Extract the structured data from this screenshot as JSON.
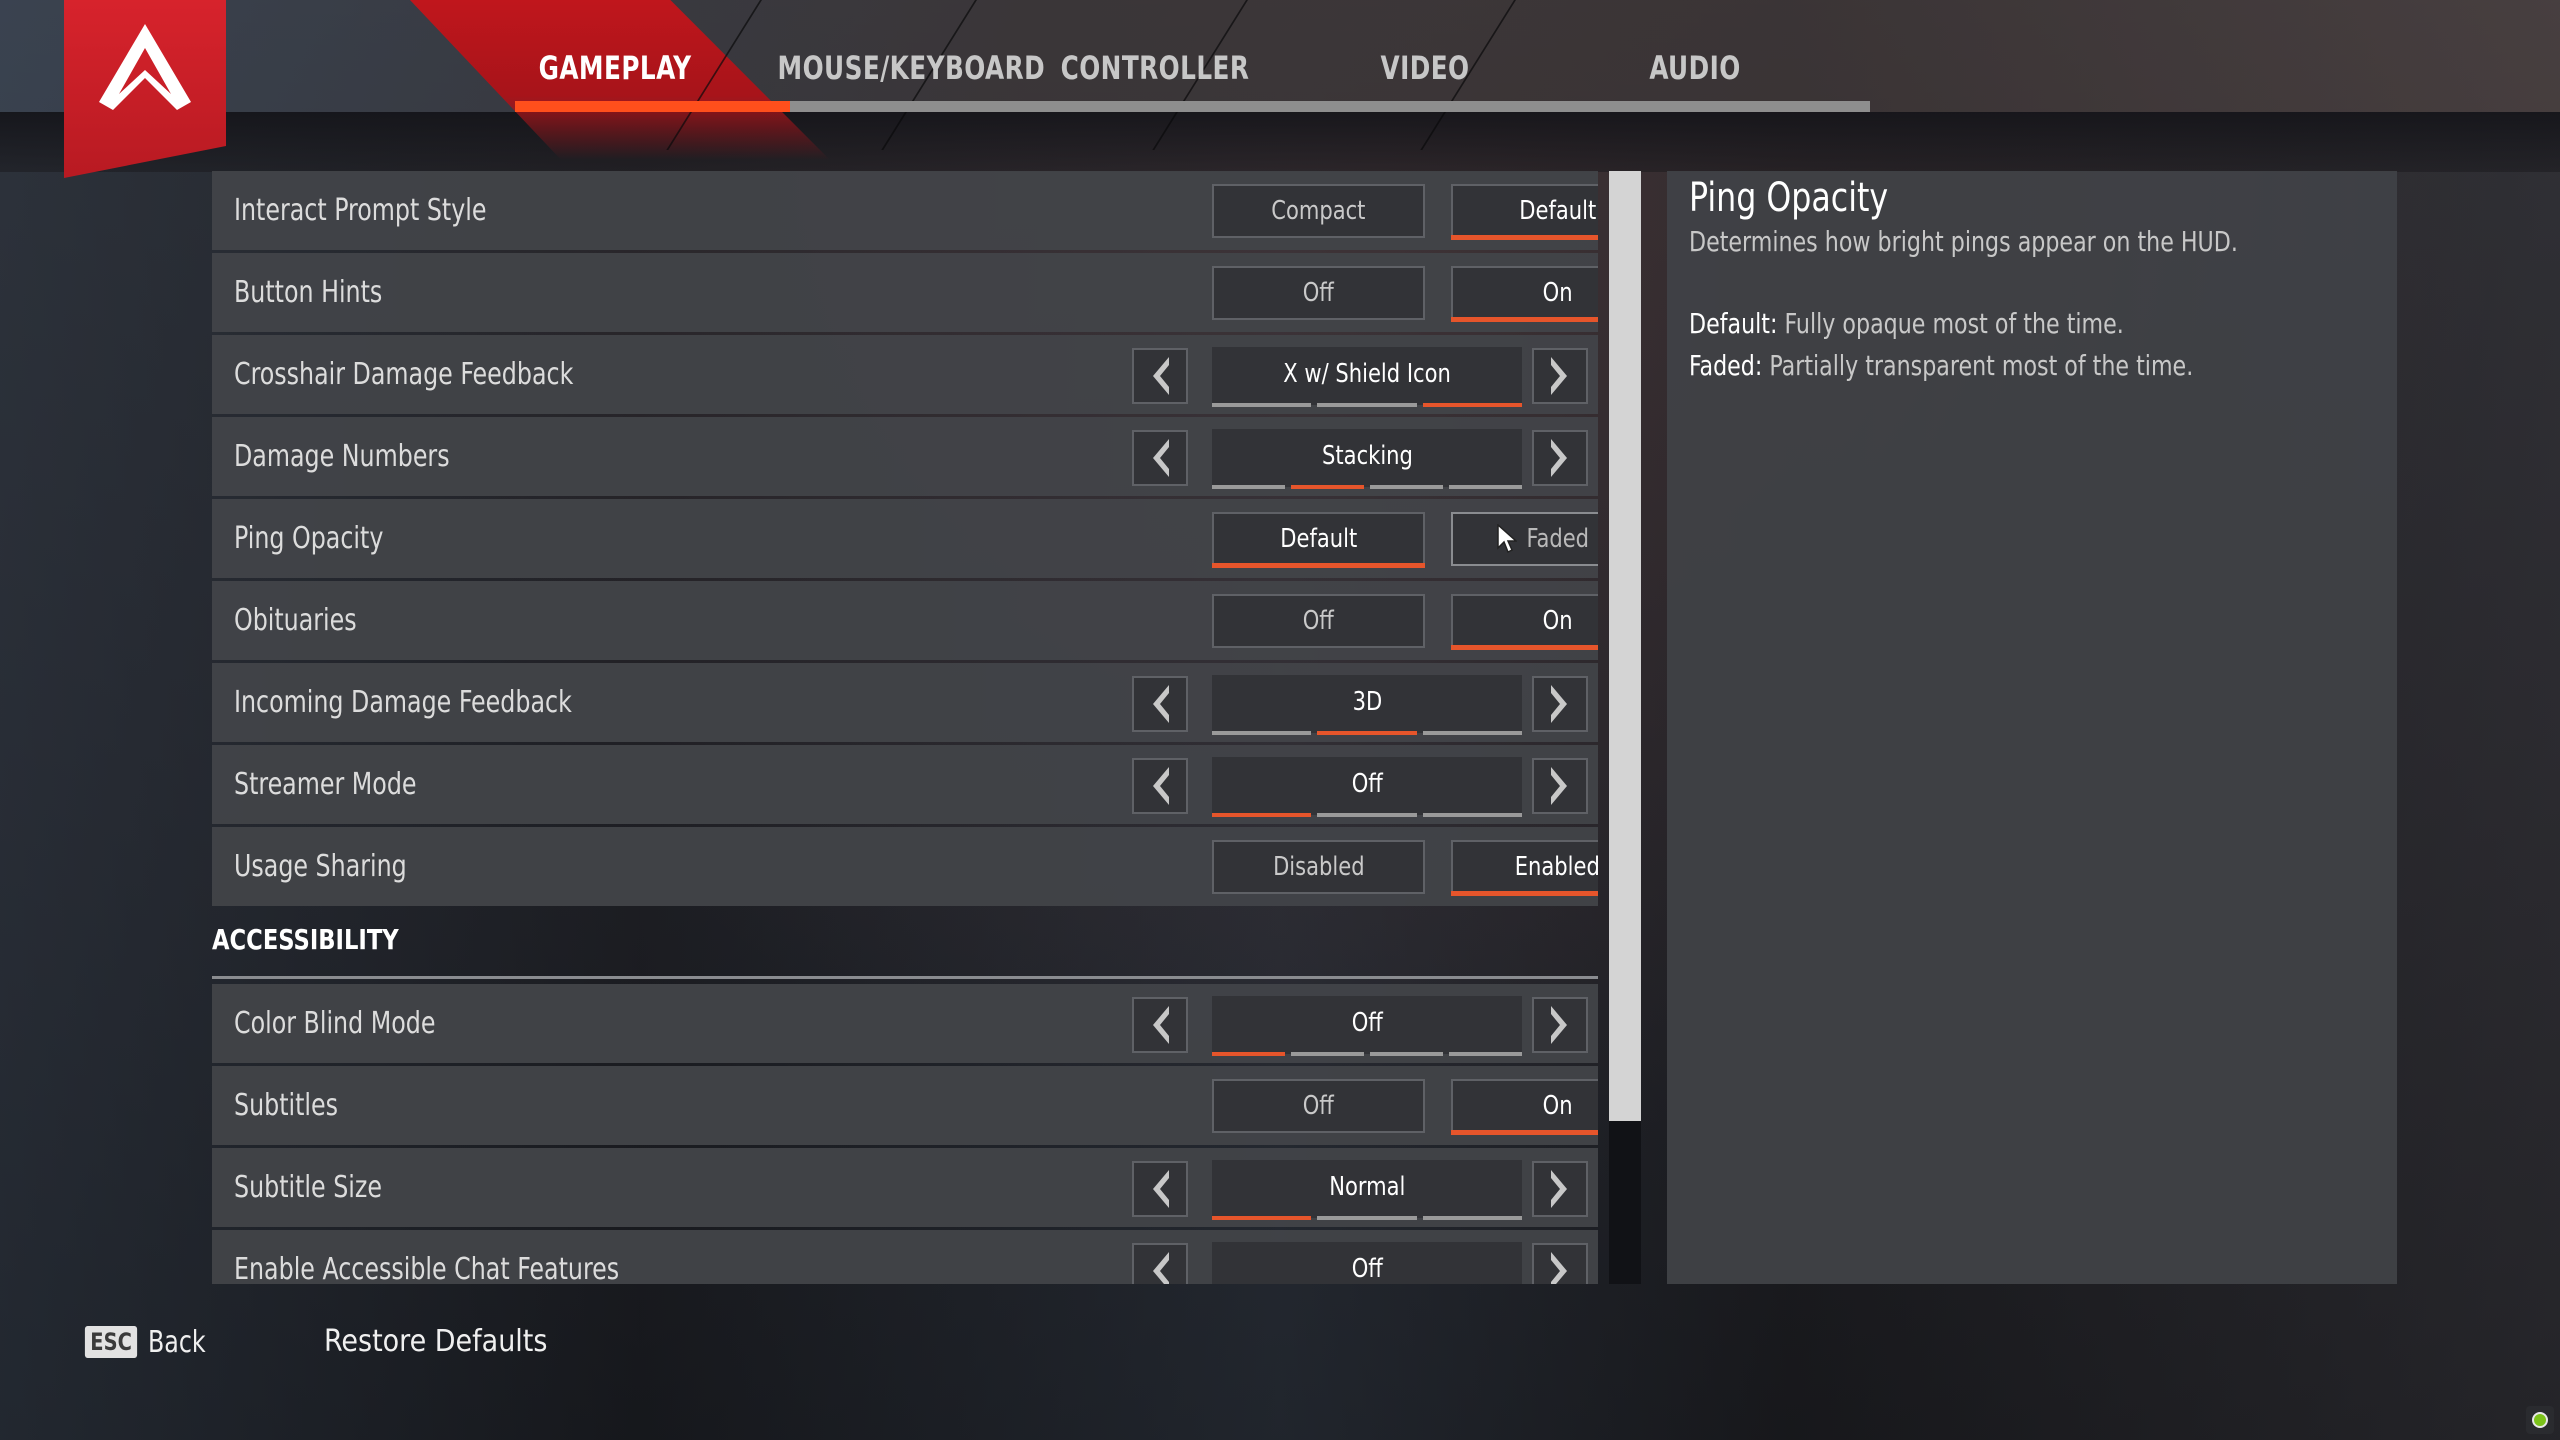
{
  "colors": {
    "accent": "#e6552b",
    "tab_active_underline": "#ff4f1c",
    "logo_red": "#d7232c",
    "status_green": "#7bc21a"
  },
  "logo": {
    "icon": "apex-logo-icon"
  },
  "tabs": [
    {
      "label": "GAMEPLAY",
      "active": true
    },
    {
      "label": "MOUSE/KEYBOARD",
      "active": false
    },
    {
      "label": "CONTROLLER",
      "active": false
    },
    {
      "label": "VIDEO",
      "active": false
    },
    {
      "label": "AUDIO",
      "active": false
    }
  ],
  "settings": {
    "rows": [
      {
        "label": "Interact Prompt Style",
        "type": "toggle",
        "options": [
          "Compact",
          "Default"
        ],
        "selected": 1
      },
      {
        "label": "Button Hints",
        "type": "toggle",
        "options": [
          "Off",
          "On"
        ],
        "selected": 1
      },
      {
        "label": "Crosshair Damage Feedback",
        "type": "cycler",
        "value": "X w/ Shield Icon",
        "segments": 3,
        "selected_segment": 2
      },
      {
        "label": "Damage Numbers",
        "type": "cycler",
        "value": "Stacking",
        "segments": 4,
        "selected_segment": 1
      },
      {
        "label": "Ping Opacity",
        "type": "toggle",
        "options": [
          "Default",
          "Faded"
        ],
        "selected": 0,
        "hovered": 1
      },
      {
        "label": "Obituaries",
        "type": "toggle",
        "options": [
          "Off",
          "On"
        ],
        "selected": 1
      },
      {
        "label": "Incoming Damage Feedback",
        "type": "cycler",
        "value": "3D",
        "segments": 3,
        "selected_segment": 1
      },
      {
        "label": "Streamer Mode",
        "type": "cycler",
        "value": "Off",
        "segments": 3,
        "selected_segment": 0
      },
      {
        "label": "Usage Sharing",
        "type": "toggle",
        "options": [
          "Disabled",
          "Enabled"
        ],
        "selected": 1
      }
    ],
    "accessibility_header": "ACCESSIBILITY",
    "accessibility_rows": [
      {
        "label": "Color Blind Mode",
        "type": "cycler",
        "value": "Off",
        "segments": 4,
        "selected_segment": 0
      },
      {
        "label": "Subtitles",
        "type": "toggle",
        "options": [
          "Off",
          "On"
        ],
        "selected": 1
      },
      {
        "label": "Subtitle Size",
        "type": "cycler",
        "value": "Normal",
        "segments": 3,
        "selected_segment": 0
      },
      {
        "label": "Enable Accessible Chat Features",
        "type": "cycler",
        "value": "Off",
        "segments": 0,
        "selected_segment": null
      }
    ],
    "scroll_position_fraction": 0.0,
    "scroll_visible_fraction": 0.85
  },
  "info_panel": {
    "title": "Ping Opacity",
    "description": "Determines how bright pings appear on the HUD.",
    "details": [
      {
        "term": "Default:",
        "text": " Fully opaque most of the time."
      },
      {
        "term": "Faded:",
        "text": " Partially transparent most of the time."
      }
    ]
  },
  "footer": {
    "back_key": "ESC",
    "back_label": "Back",
    "restore_label": "Restore Defaults"
  },
  "status_indicator": {
    "icon": "sync-status-icon",
    "state": "online"
  }
}
